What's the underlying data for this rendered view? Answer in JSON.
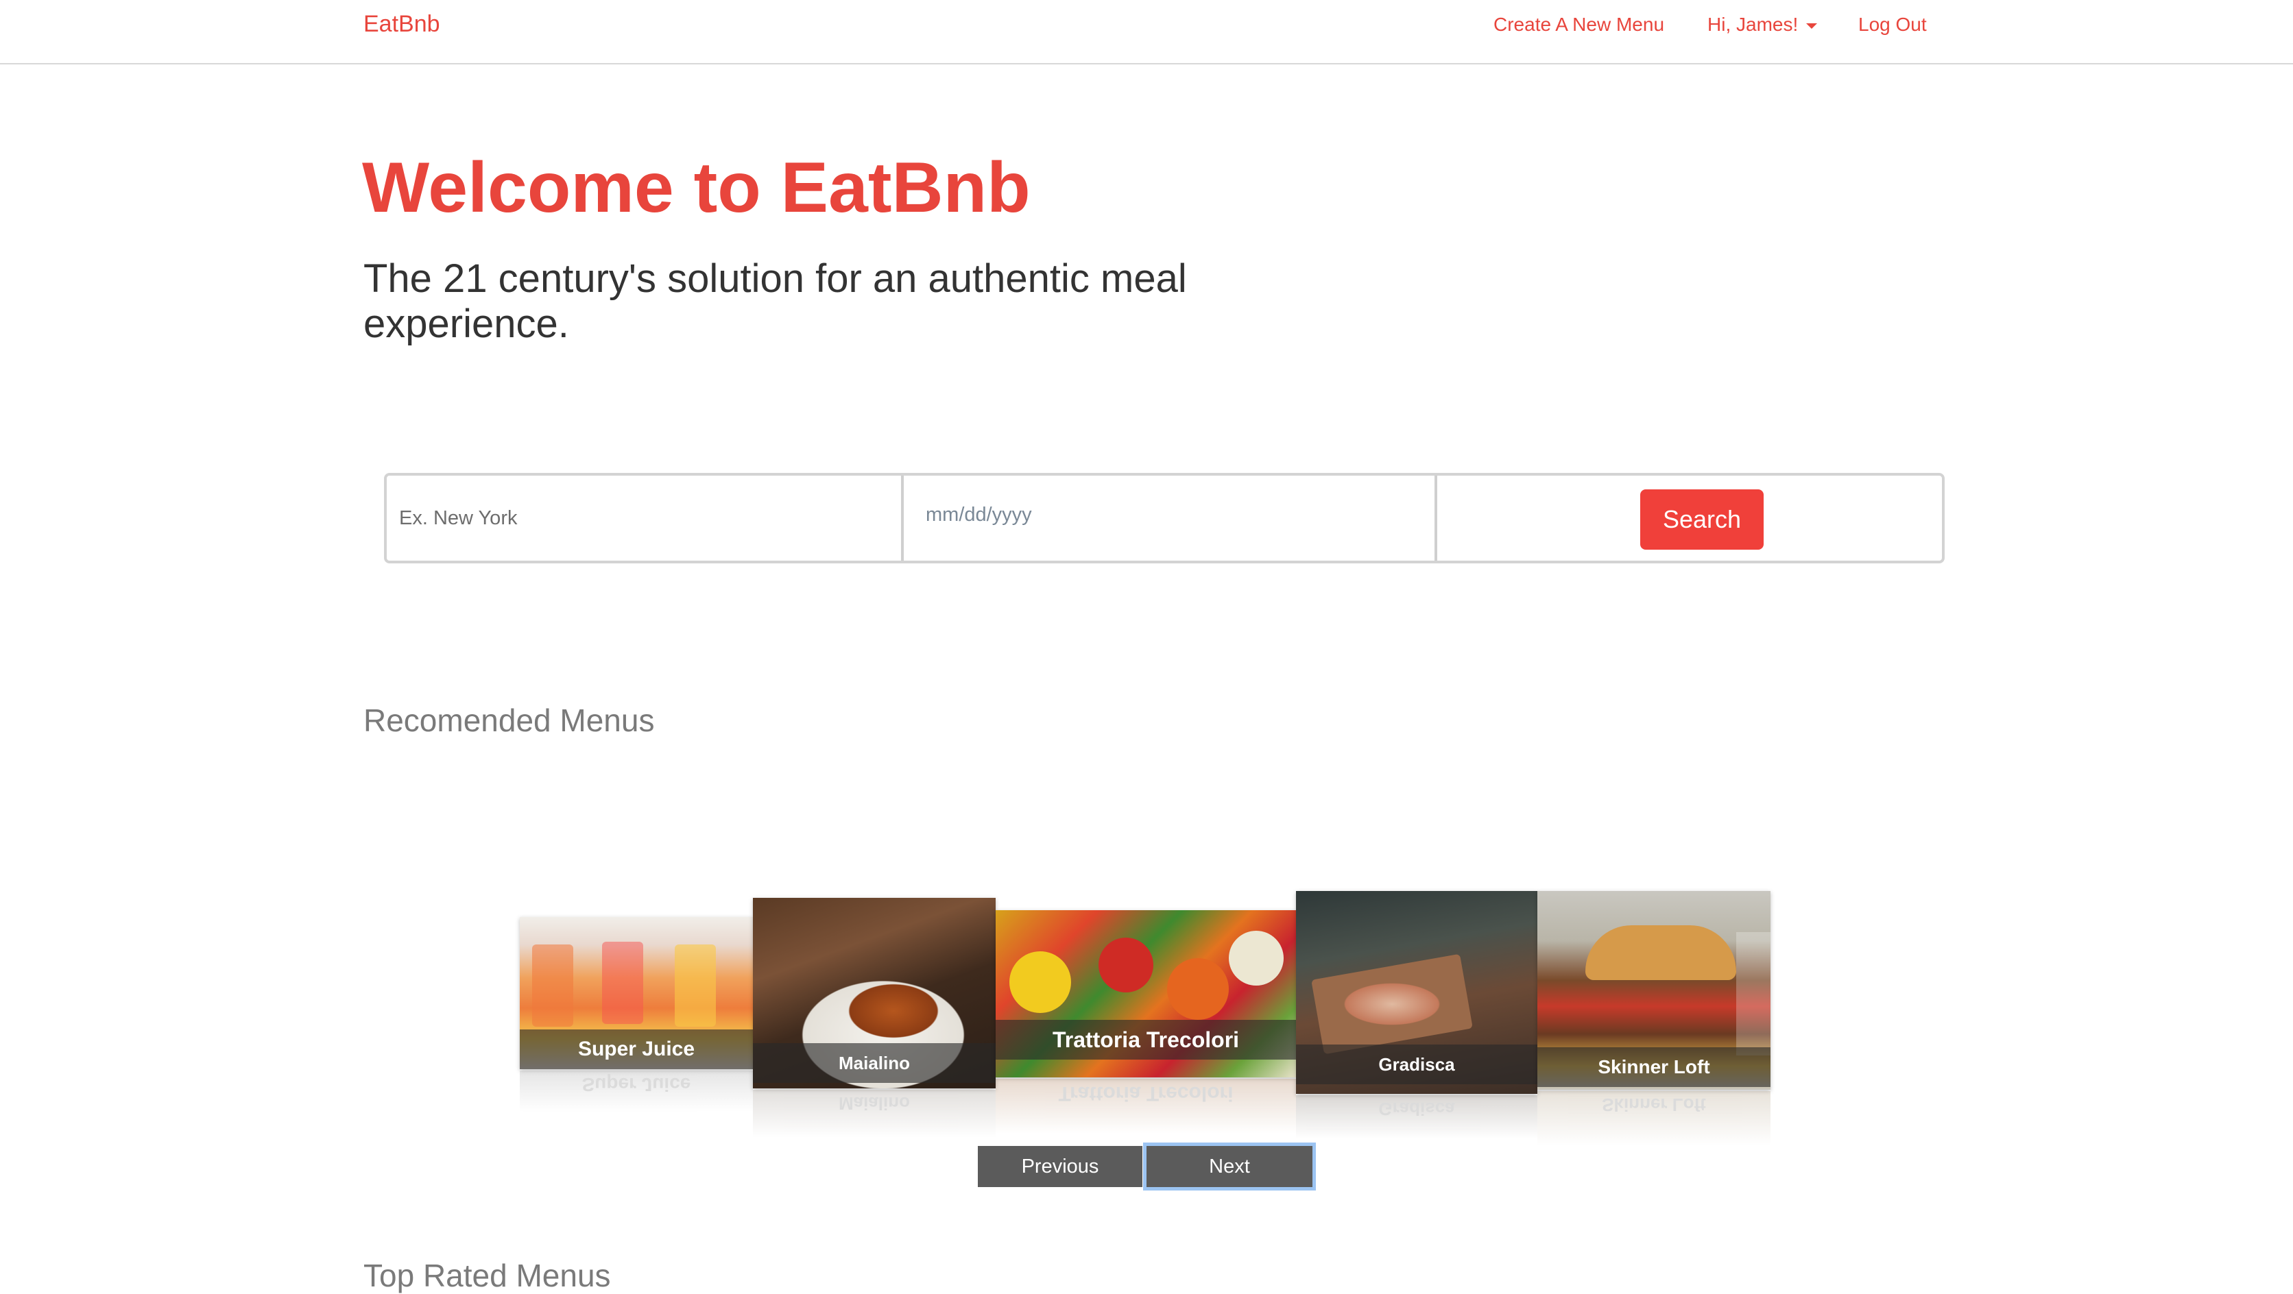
{
  "navbar": {
    "brand": "EatBnb",
    "create_menu": "Create A New Menu",
    "user_greeting": "Hi, James!",
    "logout": "Log Out"
  },
  "hero": {
    "title": "Welcome to EatBnb",
    "subtitle": "The 21 century's solution for an authentic meal experience."
  },
  "search": {
    "location_placeholder": "Ex. New York",
    "location_value": "",
    "date_placeholder": "mm/dd/yyyy",
    "date_value": "",
    "button_label": "Search"
  },
  "recommended": {
    "heading": "Recomended Menus",
    "menus": [
      {
        "name": "Super Juice"
      },
      {
        "name": "Maialino"
      },
      {
        "name": "Trattoria Trecolori"
      },
      {
        "name": "Gradisca"
      },
      {
        "name": "Skinner Loft"
      }
    ],
    "previous_label": "Previous",
    "next_label": "Next"
  },
  "top_rated": {
    "heading": "Top Rated Menus"
  },
  "colors": {
    "brand": "#e8453c",
    "search_button": "#f0403a",
    "carousel_button": "#5b5b5b",
    "focus_ring": "#9cc4f2"
  }
}
